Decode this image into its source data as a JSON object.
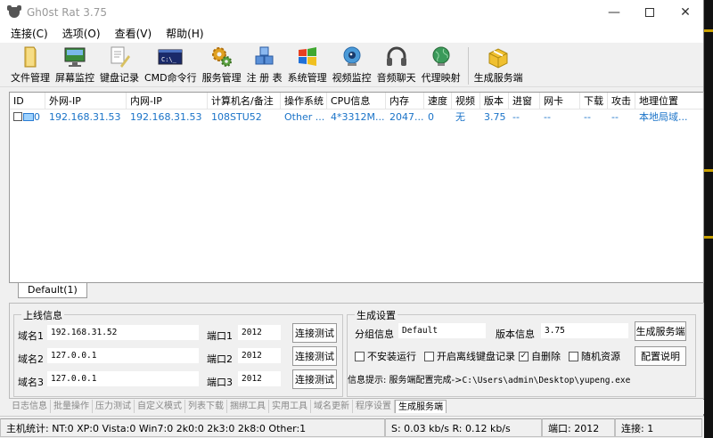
{
  "window": {
    "title": "Gh0st Rat 3.75"
  },
  "menu": [
    "连接(C)",
    "选项(O)",
    "查看(V)",
    "帮助(H)"
  ],
  "toolbar": [
    "文件管理",
    "屏幕监控",
    "键盘记录",
    "CMD命令行",
    "服务管理",
    "注 册 表",
    "系统管理",
    "视频监控",
    "音频聊天",
    "代理映射",
    "生成服务端"
  ],
  "table": {
    "columns": [
      "ID",
      "外网-IP",
      "内网-IP",
      "计算机名/备注",
      "操作系统",
      "CPU信息",
      "内存",
      "速度",
      "视频",
      "版本",
      "进窗",
      "网卡",
      "下载",
      "攻击",
      "地理位置"
    ],
    "rows": [
      [
        "0",
        "192.168.31.53",
        "192.168.31.53",
        "108STU52",
        "Other ...",
        "4*3312M...",
        "2047...",
        "0",
        "无",
        "3.75",
        "--",
        "--",
        "--",
        "--",
        "本地局域..."
      ]
    ]
  },
  "group_tab": "Default(1)",
  "online": {
    "legend": "上线信息",
    "rows": [
      {
        "label": "域名1",
        "host": "192.168.31.52",
        "port_label": "端口1",
        "port": "2012",
        "test": "连接测试"
      },
      {
        "label": "域名2",
        "host": "127.0.0.1",
        "port_label": "端口2",
        "port": "2012",
        "test": "连接测试"
      },
      {
        "label": "域名3",
        "host": "127.0.0.1",
        "port_label": "端口3",
        "port": "2012",
        "test": "连接测试"
      }
    ]
  },
  "gen": {
    "legend": "生成设置",
    "group_label": "分组信息",
    "group_value": "Default",
    "version_label": "版本信息",
    "version_value": "3.75",
    "gen_button": "生成服务端",
    "config_button": "配置说明",
    "checks": [
      {
        "label": "不安装运行",
        "checked": false
      },
      {
        "label": "开启离线键盘记录",
        "checked": false
      },
      {
        "label": "自删除",
        "checked": true
      },
      {
        "label": "随机资源",
        "checked": false
      }
    ],
    "info_prefix": "信息提示: 服务端配置完成->",
    "info_path": "C:\\Users\\admin\\Desktop\\yupeng.exe"
  },
  "bottom_tabs": [
    "日志信息",
    "批量操作",
    "压力测试",
    "自定义模式",
    "列表下载",
    "捆绑工具",
    "实用工具",
    "域名更新",
    "程序设置",
    "生成服务端"
  ],
  "status": {
    "hosts": "主机统计: NT:0  XP:0  Vista:0  Win7:0  2k0:0  2k3:0  2k8:0  Other:1",
    "speed": "S: 0.03 kb/s  R: 0.12 kb/s",
    "port": "端口: 2012",
    "conn": "连接: 1"
  },
  "colors": {
    "accent": "#1a73c8"
  }
}
